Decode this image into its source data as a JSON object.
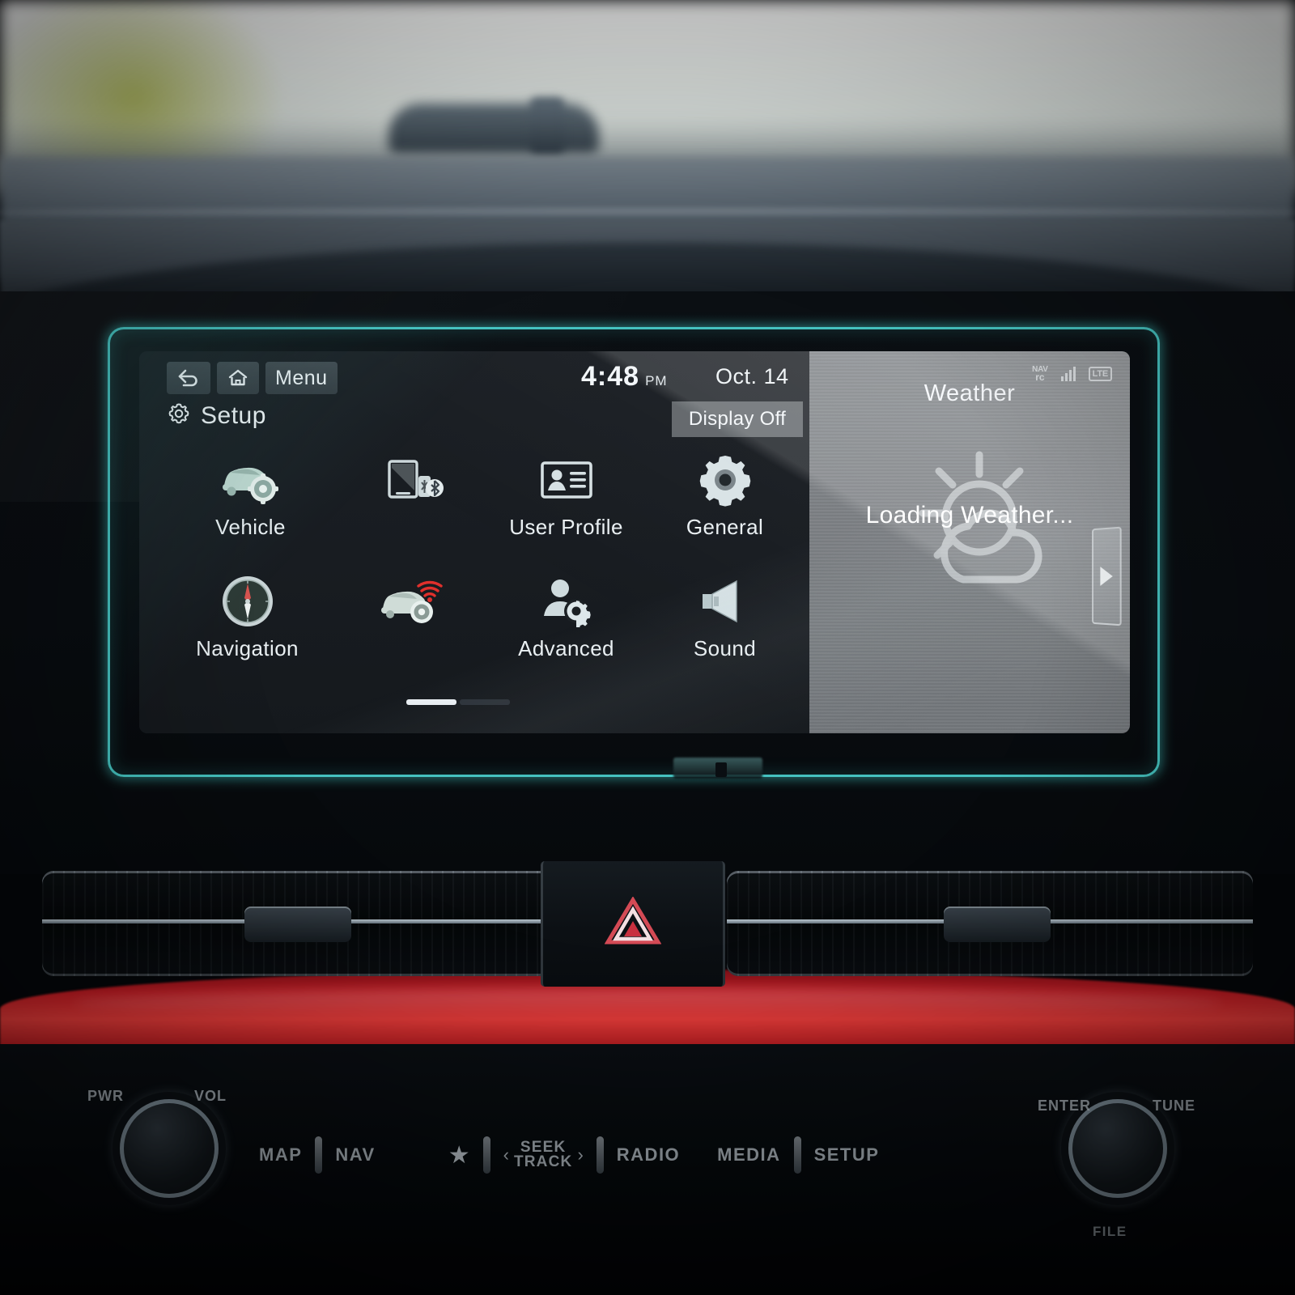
{
  "scene": {
    "description": "Kia infotainment head unit Setup screen with tempered glass screen protector installed",
    "protector_edge_color": "#50e2de",
    "trim_accent_color": "#c11b22"
  },
  "screen": {
    "statusbar": {
      "back_icon": "back-arrow-icon",
      "home_icon": "home-icon",
      "menu_label": "Menu",
      "time": "4:48",
      "meridiem": "PM",
      "date": "Oct. 14",
      "nav_indicator_top": "NAV",
      "nav_indicator_bottom": "rc",
      "signal_icon": "signal-bars-icon",
      "network_label": "LTE"
    },
    "header": {
      "gear_icon": "gear-icon",
      "title": "Setup",
      "display_off_label": "Display Off"
    },
    "menu_items": [
      {
        "label": "Vehicle",
        "icon": "car-settings-icon",
        "visible_label": true
      },
      {
        "label": "",
        "icon": "device-bluetooth-icon",
        "visible_label": false
      },
      {
        "label": "User Profile",
        "icon": "id-card-icon",
        "visible_label": true
      },
      {
        "label": "General",
        "icon": "gear-icon",
        "visible_label": true
      },
      {
        "label": "Navigation",
        "icon": "compass-icon",
        "visible_label": true
      },
      {
        "label": "",
        "icon": "connected-car-icon",
        "visible_label": false
      },
      {
        "label": "Advanced",
        "icon": "user-gear-icon",
        "visible_label": true
      },
      {
        "label": "Sound",
        "icon": "speaker-icon",
        "visible_label": true
      }
    ],
    "pager": {
      "pages": 2,
      "active": 1
    },
    "weather_widget": {
      "title": "Weather",
      "status": "Loading Weather...",
      "icon": "sun-behind-cloud-icon",
      "next_arrow_icon": "chevron-right-icon"
    }
  },
  "hardware": {
    "left_knob": {
      "top_label": "PWR",
      "right_label": "VOL"
    },
    "right_knob": {
      "top_label": "ENTER",
      "right_label": "TUNE",
      "bottom_label": "FILE"
    },
    "buttons": [
      {
        "label": "MAP",
        "type": "text"
      },
      {
        "label": "NAV",
        "type": "text"
      },
      {
        "label": "",
        "type": "star-icon"
      },
      {
        "label": "SEEK",
        "label2": "TRACK",
        "type": "seek"
      },
      {
        "label": "RADIO",
        "type": "text"
      },
      {
        "label": "MEDIA",
        "type": "text"
      },
      {
        "label": "SETUP",
        "type": "text"
      }
    ],
    "hazard_icon": "hazard-triangle-icon"
  }
}
